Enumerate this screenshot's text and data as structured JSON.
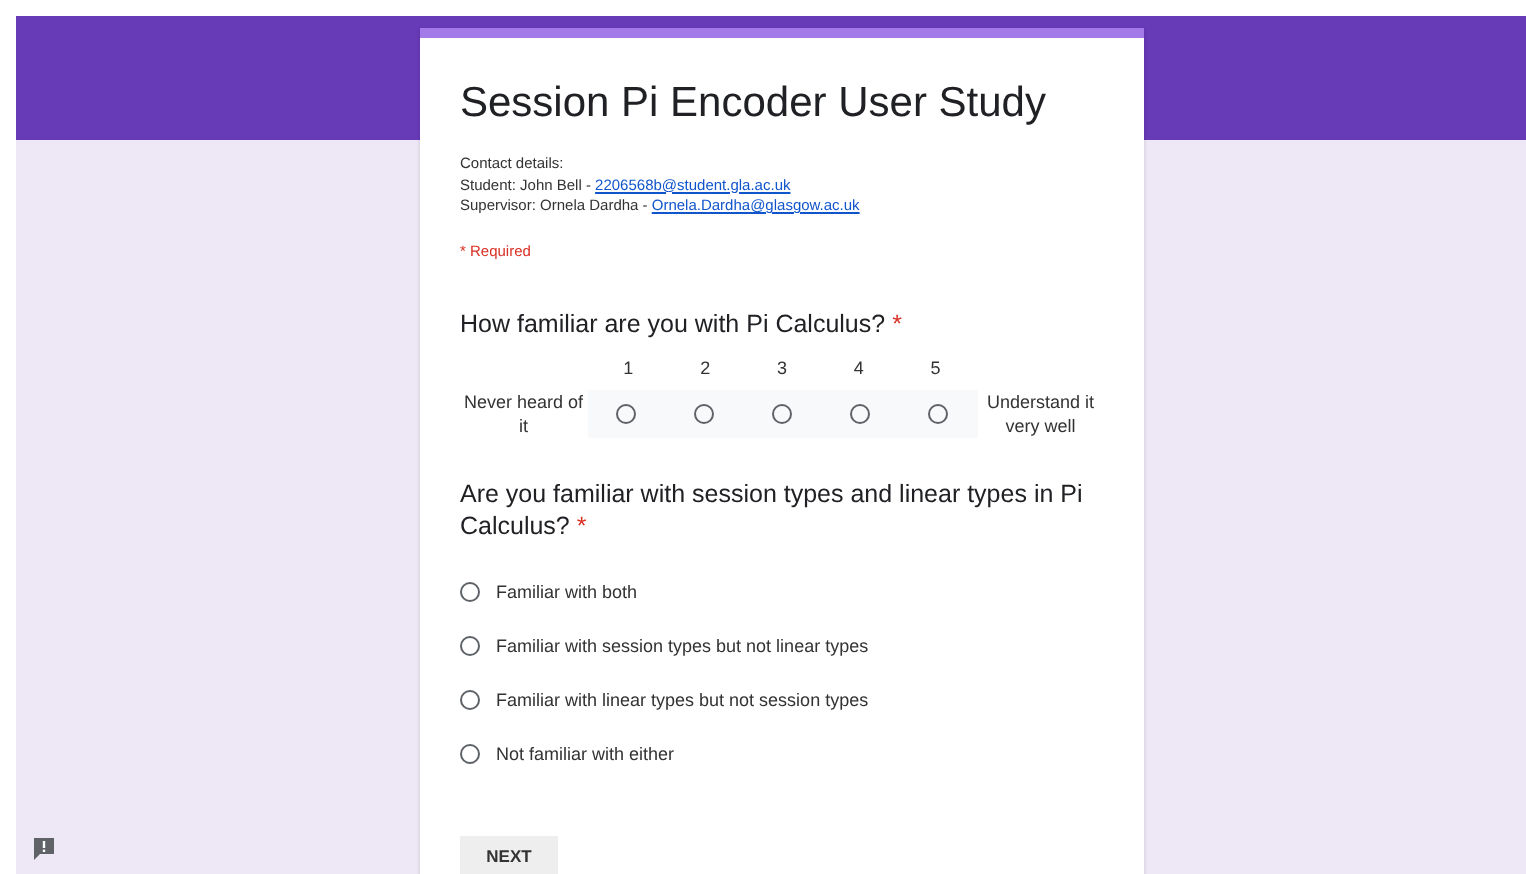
{
  "form": {
    "title": "Session Pi Encoder User Study",
    "contact": {
      "heading": "Contact details:",
      "lines": [
        {
          "text": "Student: John Bell - ",
          "link": "2206568b@student.gla.ac.uk"
        },
        {
          "text": "Supervisor: Ornela Dardha - ",
          "link": "Ornela.Dardha@glasgow.ac.uk"
        }
      ]
    },
    "required_note": "* Required",
    "questions": [
      {
        "kind": "scale",
        "title": "How familiar are you with Pi Calculus?",
        "required_mark": "*",
        "low_label": "Never heard of it",
        "high_label": "Understand it very well",
        "options": [
          {
            "label": "1",
            "selected": false
          },
          {
            "label": "2",
            "selected": false
          },
          {
            "label": "3",
            "selected": false
          },
          {
            "label": "4",
            "selected": false
          },
          {
            "label": "5",
            "selected": false
          }
        ]
      },
      {
        "kind": "choice",
        "title": "Are you familiar with session types and linear types in Pi Calculus?",
        "required_mark": "*",
        "options": [
          {
            "label": "Familiar with both",
            "selected": false
          },
          {
            "label": "Familiar with session types but not linear types",
            "selected": false
          },
          {
            "label": "Familiar with linear types but not session types",
            "selected": false
          },
          {
            "label": "Not familiar with either",
            "selected": false
          }
        ]
      }
    ],
    "next_button": "NEXT"
  }
}
